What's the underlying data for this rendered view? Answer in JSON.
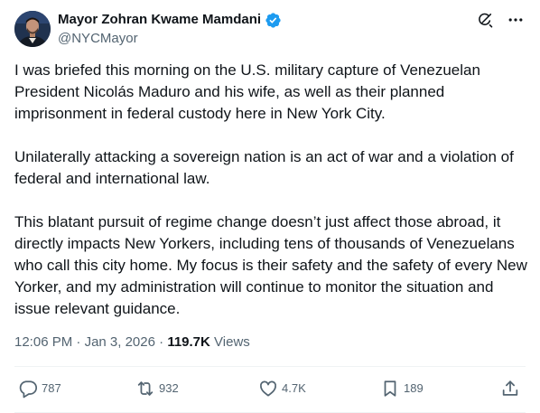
{
  "author": {
    "display_name": "Mayor Zohran Kwame Mamdani",
    "handle": "@NYCMayor",
    "verified": true,
    "avatar_icon": "avatar-photo",
    "verified_color": "#1d9bf0"
  },
  "header_actions": {
    "grok_icon": "grok-icon",
    "more_icon": "more-icon"
  },
  "tweet": {
    "paragraphs": [
      "I was briefed this morning on the U.S. military capture of Venezuelan President Nicolás Maduro and his wife, as well as their planned imprisonment in federal custody here in New York City.",
      "Unilaterally attacking a sovereign nation is an act of war and a violation of federal and international law.",
      "This blatant pursuit of regime change doesn’t just affect those abroad, it directly impacts New Yorkers, including tens of thousands of Venezuelans who call this city home. My focus is their safety and the safety of every New Yorker, and my administration will continue to monitor the situation and issue relevant guidance."
    ],
    "time": "12:06 PM",
    "separator": "·",
    "date": "Jan 3, 2026",
    "views_count": "119.7K",
    "views_label": "Views"
  },
  "actions": {
    "reply_count": "787",
    "repost_count": "932",
    "like_count": "4.7K",
    "bookmark_count": "189",
    "icon_color": "#536471"
  },
  "colors": {
    "text": "#0f1419",
    "secondary": "#536471",
    "divider": "#eff3f4",
    "accent": "#1d9bf0"
  }
}
